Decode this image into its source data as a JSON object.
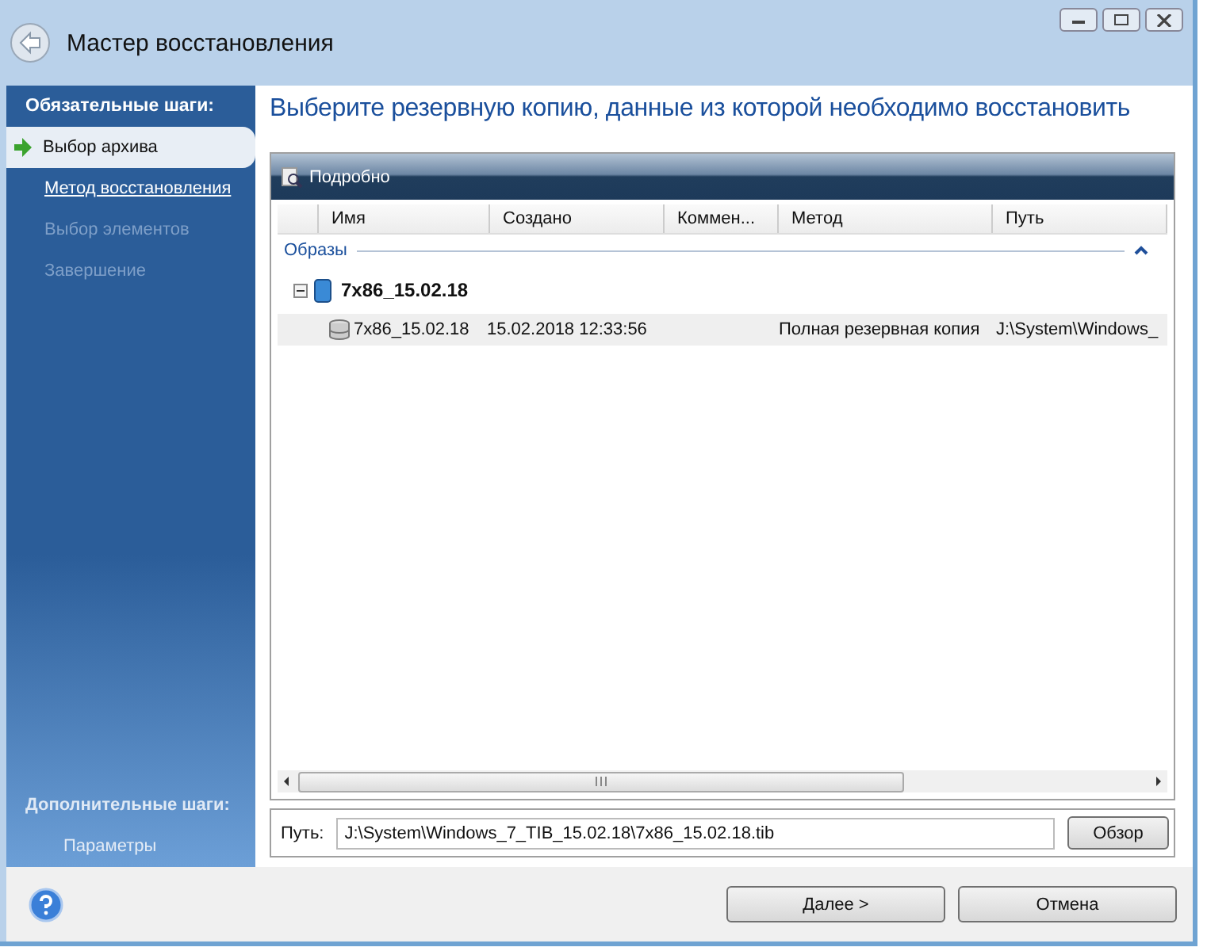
{
  "window": {
    "title": "Мастер восстановления"
  },
  "sidebar": {
    "required_title": "Обязательные шаги:",
    "steps": [
      {
        "label": "Выбор архива",
        "kind": "current"
      },
      {
        "label": "Метод восстановления",
        "kind": "link"
      },
      {
        "label": "Выбор элементов",
        "kind": "disabled"
      },
      {
        "label": "Завершение",
        "kind": "disabled"
      }
    ],
    "optional_title": "Дополнительные шаги:",
    "optional_steps": [
      {
        "label": "Параметры",
        "kind": "disabled"
      }
    ]
  },
  "heading": "Выберите резервную копию, данные из которой необходимо восстановить",
  "toolbar": {
    "details_button": "Подробно"
  },
  "table": {
    "columns": [
      "Имя",
      "Создано",
      "Коммен...",
      "Метод",
      "Путь"
    ],
    "group": {
      "label": "Образы",
      "expanded": true
    },
    "tree": [
      {
        "name": "7x86_15.02.18",
        "expanded": true,
        "children": [
          {
            "cells": [
              "7x86_15.02.18",
              "15.02.2018 12:33:56",
              "",
              "Полная резервная копия",
              "J:\\System\\Windows_"
            ],
            "selected": true
          }
        ]
      }
    ]
  },
  "path": {
    "label": "Путь:",
    "value": "J:\\System\\Windows_7_TIB_15.02.18\\7x86_15.02.18.tib",
    "browse_button": "Обзор"
  },
  "buttons": {
    "next": "Далее >",
    "cancel": "Отмена"
  }
}
